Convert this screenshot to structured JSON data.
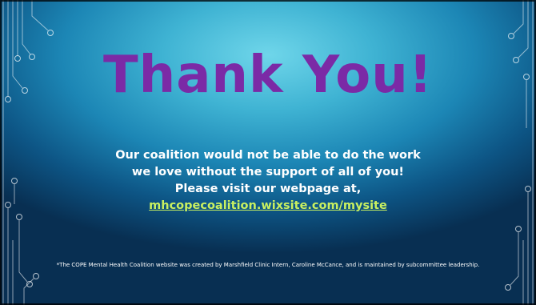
{
  "slide": {
    "title": "Thank You!",
    "message_lines": [
      "Our coalition would not be able to do the work",
      "we love without the support of all of you!",
      "Please visit our webpage at,"
    ],
    "link_text": "mhcopecoalition.wixsite.com/mysite",
    "footnote": "*The COPE Mental Health Coalition website was created by Marshfield Clinic Intern, Caroline McCance, and is maintained by subcommittee leadership."
  },
  "colors": {
    "title": "#7b2aa6",
    "link": "#c9f060",
    "text": "#ffffff",
    "background": "#1c86b5"
  },
  "decor": {
    "left": "circuit-lines",
    "right": "circuit-lines"
  }
}
